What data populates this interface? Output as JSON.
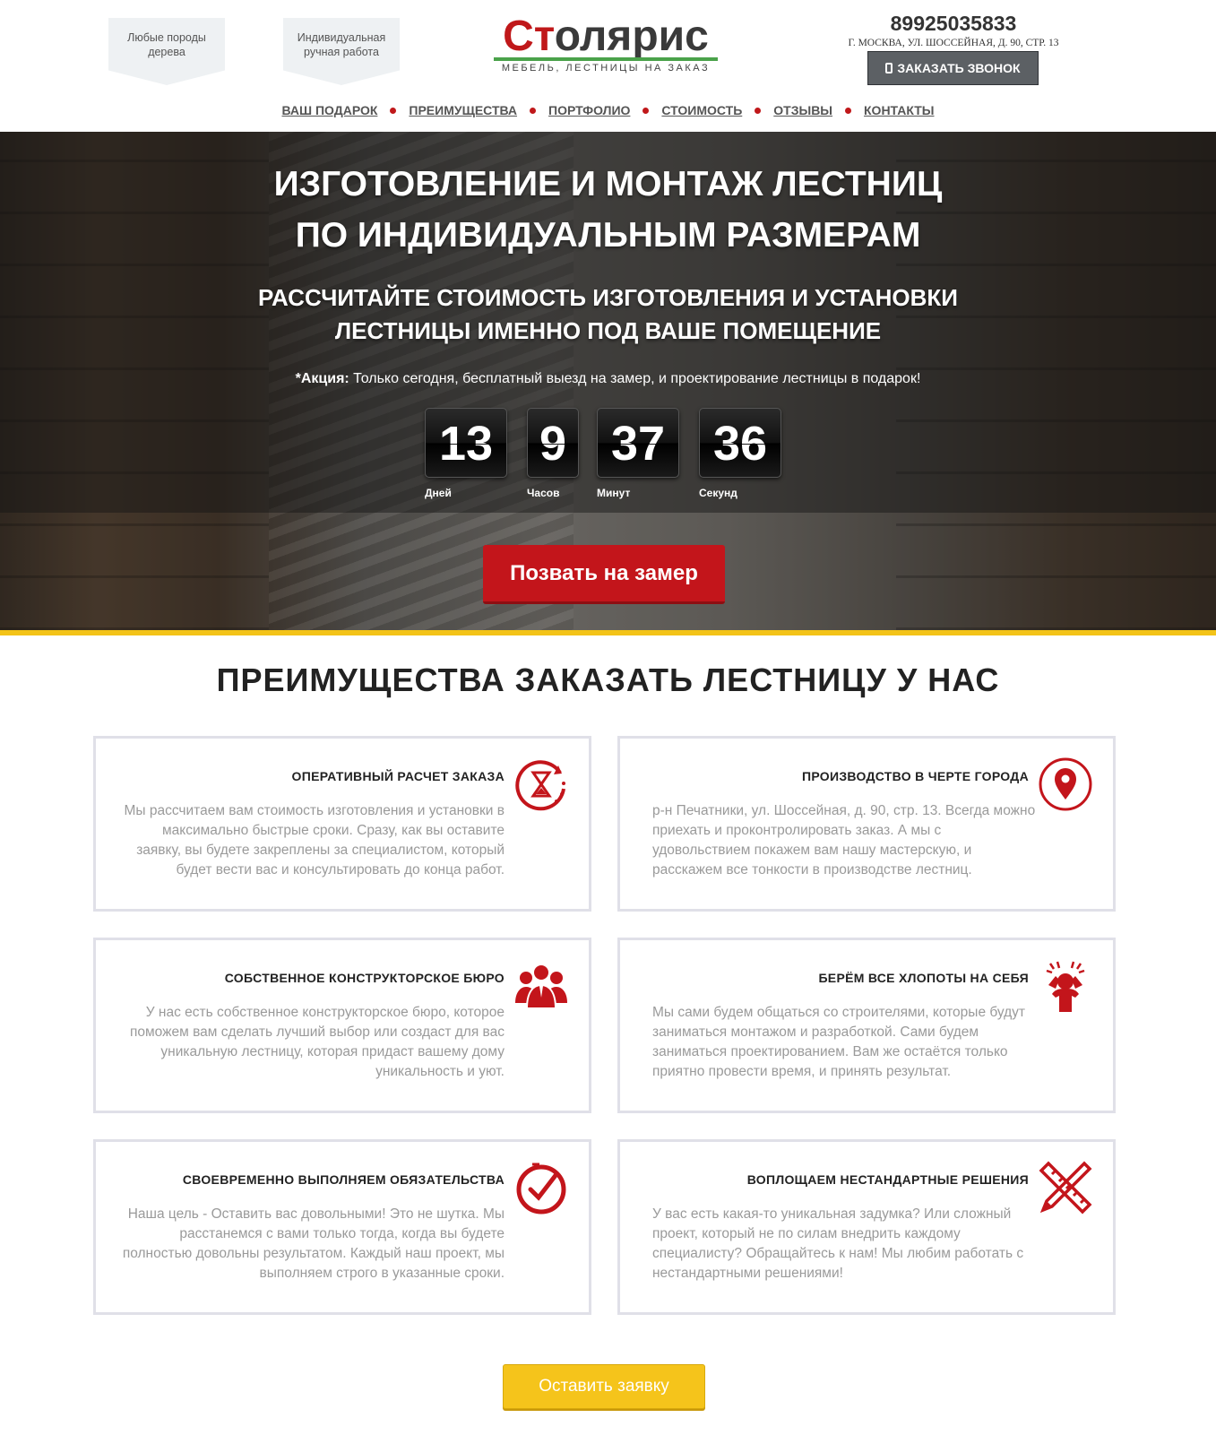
{
  "header": {
    "badge_1": {
      "line1": "Любые породы",
      "line2": "дерева"
    },
    "badge_2": {
      "line1": "Индивидуальная",
      "line2": "ручная работа"
    },
    "logo": {
      "word_accent": "Ст",
      "word_rest": "олярис",
      "tagline": "МЕБЕЛЬ, ЛЕСТНИЦЫ НА ЗАКАЗ"
    },
    "phone": "89925035833",
    "address": "Г. МОСКВА, УЛ. ШОССЕЙНАЯ, Д. 90, СТР. 13",
    "call_button": "ЗАКАЗАТЬ ЗВОНОК"
  },
  "nav": {
    "items": [
      "ВАШ ПОДАРОК",
      "ПРЕИМУЩЕСТВА",
      "ПОРТФОЛИО",
      "СТОИМОСТЬ",
      "ОТЗЫВЫ",
      "КОНТАКТЫ"
    ]
  },
  "hero": {
    "title_line1": "ИЗГОТОВЛЕНИЕ И МОНТАЖ ЛЕСТНИЦ",
    "title_line2": "ПО ИНДИВИДУАЛЬНЫМ РАЗМЕРАМ",
    "sub_line1": "РАССЧИТАЙТЕ СТОИМОСТЬ ИЗГОТОВЛЕНИЯ И УСТАНОВКИ",
    "sub_line2": "ЛЕСТНИЦЫ ИМЕННО ПОД ВАШЕ ПОМЕЩЕНИЕ",
    "promo_label": "*Акция:",
    "promo_text": " Только сегодня, бесплатный выезд на замер, и проектирование лестницы в подарок!",
    "timer": {
      "days": "13",
      "hours": "9",
      "minutes": "37",
      "seconds": "36",
      "days_label": "Дней",
      "hours_label": "Часов",
      "minutes_label": "Минут",
      "seconds_label": "Секунд"
    },
    "button": "Позвать на замер"
  },
  "advantages": {
    "title": "ПРЕИМУЩЕСТВА ЗАКАЗАТЬ ЛЕСТНИЦУ У НАС",
    "cards": [
      {
        "title": "ОПЕРАТИВНЫЙ РАСЧЕТ ЗАКАЗА",
        "icon": "hourglass-timer-icon",
        "text": "Мы рассчитаем вам стоимость изготовления и установки в максимально быстрые сроки. Сразу, как вы оставите заявку, вы будете закреплены за специалистом, который будет вести вас и консультировать до конца работ."
      },
      {
        "title": "ПРОИЗВОДСТВО В ЧЕРТЕ ГОРОДА",
        "icon": "map-pin-icon",
        "text": "р-н Печатники, ул. Шоссейная, д. 90, стр. 13. Всегда можно приехать и проконтролировать заказ. А мы с удовольствием покажем вам нашу мастерскую, и расскажем все тонкости в производстве лестниц."
      },
      {
        "title": "СОБСТВЕННОЕ КОНСТРУКТОРСКОЕ БЮРО",
        "icon": "team-icon",
        "text": "У нас есть собственное конструкторское бюро, которое поможем вам сделать лучший выбор или создаст для вас уникальную лестницу, которая придаст вашему дому уникальность и уют."
      },
      {
        "title": "БЕРЁМ ВСЕ ХЛОПОТЫ НА СЕБЯ",
        "icon": "stressed-person-icon",
        "text": "Мы сами будем общаться со строителями, которые будут заниматься монтажом и разработкой. Сами будем заниматься проектированием. Вам же остаётся только приятно провести время, и принять результат."
      },
      {
        "title": "СВОЕВРЕМЕННО ВЫПОЛНЯЕМ ОБЯЗАТЕЛЬСТВА",
        "icon": "clock-check-icon",
        "text": "Наша цель - Оставить вас довольными! Это не шутка. Мы расстанемся с вами только тогда, когда вы будете полностью довольны результатом. Каждый наш проект, мы выполняем строго в указанные сроки."
      },
      {
        "title": "ВОПЛОЩАЕМ НЕСТАНДАРТНЫЕ РЕШЕНИЯ",
        "icon": "pencil-ruler-icon",
        "text": "У вас есть какая-то уникальная задумка? Или сложный проект, который не по силам внедрить каждому специалисту? Обращайтесь к нам! Мы любим работать с нестандартными решениями!"
      }
    ],
    "button": "Оставить заявку"
  },
  "colors": {
    "accent_red": "#c3151b",
    "accent_yellow": "#f3c318",
    "logo_green": "#4aa24a"
  }
}
